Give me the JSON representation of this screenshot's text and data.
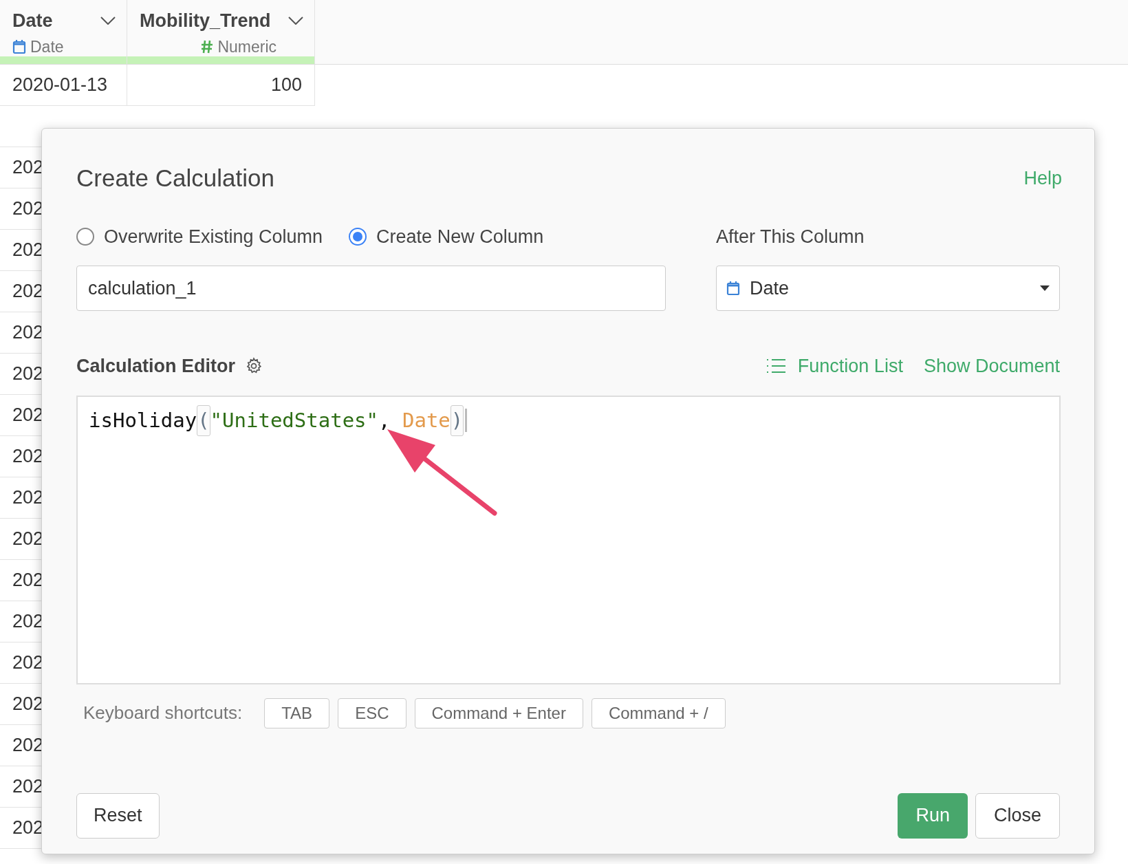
{
  "table": {
    "columns": [
      {
        "title": "Date",
        "type_label": "Date",
        "kind": "date"
      },
      {
        "title": "Mobility_Trend",
        "type_label": "Numeric",
        "kind": "numeric"
      }
    ],
    "rows": [
      [
        "2020-01-13",
        "100"
      ],
      [
        "202"
      ],
      [
        "202"
      ],
      [
        "202"
      ],
      [
        "202"
      ],
      [
        "202"
      ],
      [
        "202"
      ],
      [
        "202"
      ],
      [
        "202"
      ],
      [
        "202"
      ],
      [
        "202"
      ],
      [
        "202"
      ],
      [
        "202"
      ],
      [
        "202"
      ],
      [
        "202"
      ],
      [
        "202"
      ],
      [
        "202"
      ],
      [
        "202"
      ]
    ]
  },
  "dialog": {
    "title": "Create Calculation",
    "help": "Help",
    "options": [
      {
        "label": "Overwrite Existing Column",
        "selected": false
      },
      {
        "label": "Create New Column",
        "selected": true
      }
    ],
    "column_name": "calculation_1",
    "after_label": "After This Column",
    "after_value": "Date",
    "editor_label": "Calculation Editor",
    "function_list": "Function List",
    "show_document": "Show Document",
    "code": [
      {
        "text": "isHoliday",
        "kind": "function"
      },
      {
        "text": "(",
        "kind": "bracket"
      },
      {
        "text": "\"UnitedStates\"",
        "kind": "string"
      },
      {
        "text": ", ",
        "kind": "plain"
      },
      {
        "text": "Date",
        "kind": "column"
      },
      {
        "text": ")",
        "kind": "bracket"
      }
    ],
    "shortcuts_label": "Keyboard shortcuts:",
    "shortcuts": [
      "TAB",
      "ESC",
      "Command + Enter",
      "Command + /"
    ],
    "buttons": {
      "reset": "Reset",
      "run": "Run",
      "close": "Close"
    }
  }
}
